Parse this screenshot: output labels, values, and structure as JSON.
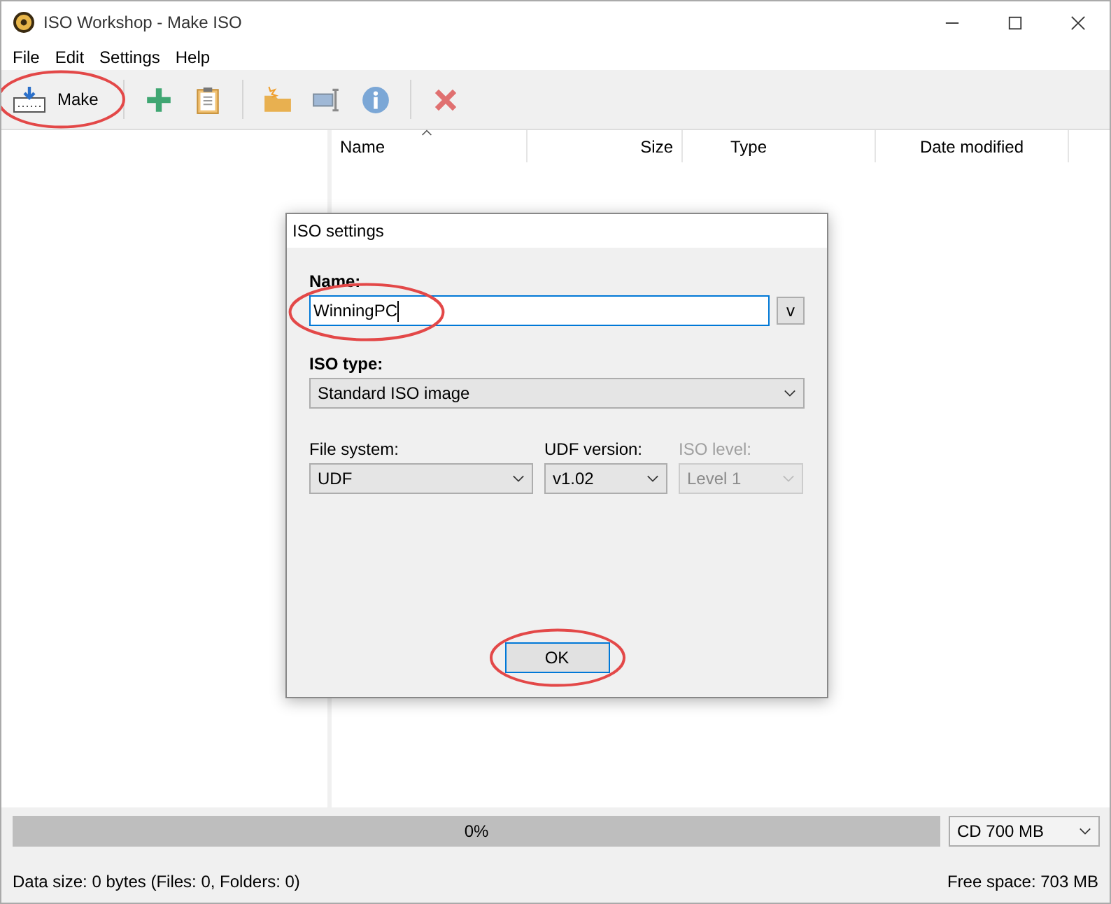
{
  "window": {
    "title": "ISO Workshop - Make ISO"
  },
  "menu": [
    "File",
    "Edit",
    "Settings",
    "Help"
  ],
  "toolbar": [
    {
      "kind": "make",
      "label": "Make",
      "highlighted": true
    },
    {
      "kind": "separator"
    },
    {
      "kind": "add"
    },
    {
      "kind": "paste"
    },
    {
      "kind": "separator"
    },
    {
      "kind": "new-folder"
    },
    {
      "kind": "rename"
    },
    {
      "kind": "info"
    },
    {
      "kind": "separator"
    },
    {
      "kind": "delete"
    }
  ],
  "table": {
    "columns": [
      {
        "label": "Name",
        "sorted": true
      },
      {
        "label": "Size",
        "sorted": false
      },
      {
        "label": "Type",
        "sorted": false
      },
      {
        "label": "Date modified",
        "sorted": false
      }
    ]
  },
  "dialog": {
    "title": "ISO settings",
    "name": {
      "label": "Name:",
      "value": "WinningPC",
      "highlighted": true,
      "button": "v"
    },
    "iso_type": {
      "label": "ISO type:",
      "value": "Standard ISO image"
    },
    "fields": [
      {
        "label": "File system:",
        "value": "UDF",
        "disabled": false
      },
      {
        "label": "UDF version:",
        "value": "v1.02",
        "disabled": false
      },
      {
        "label": "ISO level:",
        "value": "Level 1",
        "disabled": true
      }
    ],
    "ok": {
      "label": "OK",
      "highlighted": true
    }
  },
  "progress": {
    "level": 0,
    "reading": "0%"
  },
  "media": {
    "value": "CD 700 MB"
  },
  "status_bar": {
    "left": "Data size: 0 bytes (Files: 0, Folders: 0)",
    "right": "Free space: 703 MB"
  }
}
